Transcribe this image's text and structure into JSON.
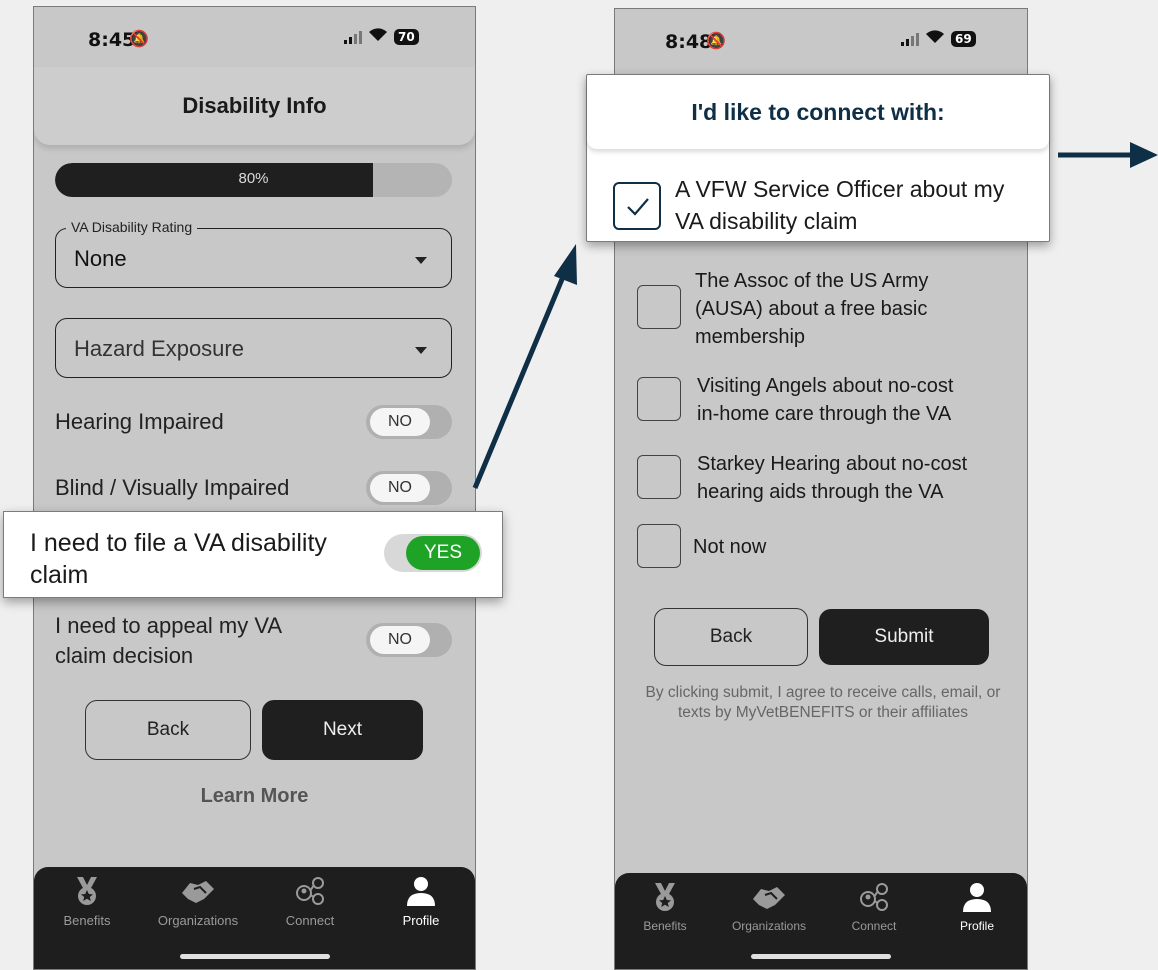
{
  "left_screen": {
    "status": {
      "time": "8:45",
      "battery": "70"
    },
    "header": {
      "title": "Disability Info"
    },
    "progress": {
      "label": "80%",
      "value": 0.8
    },
    "rating_select": {
      "legend": "VA Disability Rating",
      "value": "None"
    },
    "hazard_select": {
      "placeholder": "Hazard Exposure"
    },
    "toggles": [
      {
        "label": "Hearing Impaired",
        "state": "NO"
      },
      {
        "label": "Blind / Visually Impaired",
        "state": "NO"
      },
      {
        "label": "I need to appeal my VA claim decision",
        "label_line1": "I need to appeal my VA",
        "label_line2": "claim decision",
        "state": "NO"
      }
    ],
    "buttons": {
      "back": "Back",
      "next": "Next"
    },
    "learn_more": "Learn More"
  },
  "callout_left": {
    "text_line1": "I need to file a VA disability",
    "text_line2": "claim",
    "toggle": "YES",
    "toggle_color": "#1fa326"
  },
  "right_screen": {
    "status": {
      "time": "8:48",
      "battery": "69"
    },
    "options": [
      {
        "line1": "The Assoc of the US Army",
        "line2": "(AUSA) about a free basic",
        "line3": "membership"
      },
      {
        "line1": "Visiting Angels about no-cost",
        "line2": "in-home care through the VA"
      },
      {
        "line1": "Starkey Hearing about no-cost",
        "line2": "hearing aids through the VA"
      },
      {
        "line1": "Not now"
      }
    ],
    "buttons": {
      "back": "Back",
      "submit": "Submit"
    },
    "disclaimer": "By clicking submit, I agree to receive calls, email, or texts by MyVetBENEFITS or their affiliates"
  },
  "callout_right": {
    "heading": "I'd like to connect with:",
    "option_line1": "A VFW Service Officer about my",
    "option_line2": "VA disability claim",
    "checked": true,
    "accent": "#0e2f45"
  },
  "tabbar": {
    "items": [
      "Benefits",
      "Organizations",
      "Connect",
      "Profile"
    ],
    "active": "Profile"
  },
  "arrow_color": "#0e2f45"
}
